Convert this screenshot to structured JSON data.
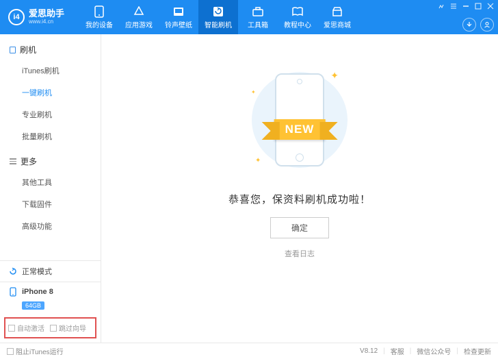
{
  "brand": {
    "name": "爱思助手",
    "url": "www.i4.cn",
    "logo_text": "i4"
  },
  "nav": [
    {
      "label": "我的设备"
    },
    {
      "label": "应用游戏"
    },
    {
      "label": "铃声壁纸"
    },
    {
      "label": "智能刷机"
    },
    {
      "label": "工具箱"
    },
    {
      "label": "教程中心"
    },
    {
      "label": "爱思商城"
    }
  ],
  "sidebar": {
    "section1": "刷机",
    "items1": [
      "iTunes刷机",
      "一键刷机",
      "专业刷机",
      "批量刷机"
    ],
    "section2": "更多",
    "items2": [
      "其他工具",
      "下载固件",
      "高级功能"
    ]
  },
  "status": {
    "mode": "正常模式",
    "device": "iPhone 8",
    "storage": "64GB"
  },
  "checks": {
    "auto_activate": "自动激活",
    "skip_guide": "跳过向导"
  },
  "main": {
    "ribbon": "NEW",
    "message": "恭喜您，保资料刷机成功啦！",
    "ok": "确定",
    "view_log": "查看日志"
  },
  "footer": {
    "block_itunes": "阻止iTunes运行",
    "version": "V8.12",
    "support": "客服",
    "wechat": "微信公众号",
    "update": "检查更新"
  }
}
